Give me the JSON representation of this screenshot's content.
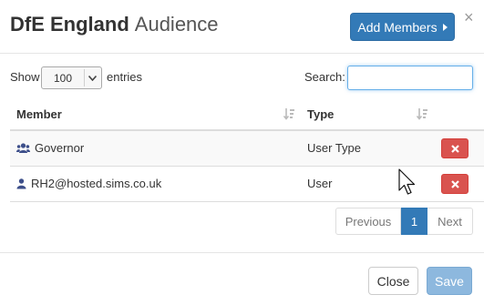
{
  "modal": {
    "title_strong": "DfE England",
    "title_light": "Audience",
    "add_members_label": "Add Members",
    "close_label": "Close",
    "save_label": "Save",
    "save_disabled": true
  },
  "table_controls": {
    "show_label": "Show",
    "page_length": "100",
    "entries_label": "entries",
    "search_label": "Search:",
    "search_value": ""
  },
  "table": {
    "columns": [
      "Member",
      "Type"
    ],
    "rows": [
      {
        "member": "Governor",
        "type": "User Type",
        "icon": "users-icon"
      },
      {
        "member": "RH2@hosted.sims.co.uk",
        "type": "User",
        "icon": "user-icon"
      }
    ]
  },
  "pagination": {
    "previous": "Previous",
    "current_page": "1",
    "next": "Next"
  },
  "colors": {
    "primary": "#337ab7",
    "danger": "#d9534f",
    "icon": "#3d4f8a"
  }
}
